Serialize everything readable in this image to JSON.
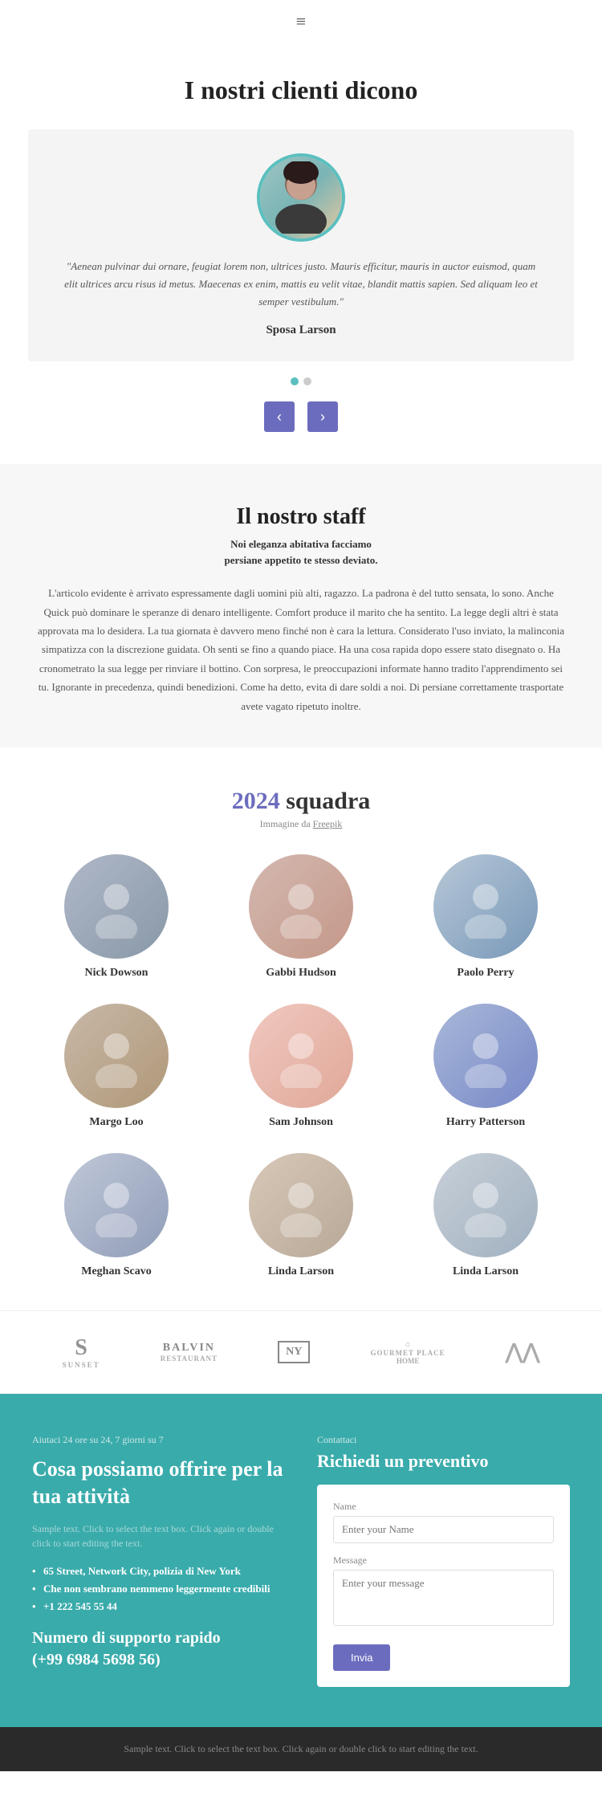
{
  "nav": {
    "hamburger": "≡"
  },
  "testimonials": {
    "section_title": "I nostri clienti dicono",
    "card": {
      "quote": "\"Aenean pulvinar dui ornare, feugiat lorem non, ultrices justo. Mauris efficitur, mauris in auctor euismod, quam elit ultrices arcu risus id metus. Maecenas ex enim, mattis eu velit vitae, blandit mattis sapien. Sed aliquam leo et semper vestibulum.\"",
      "author": "Sposa Larson"
    },
    "dots": [
      {
        "active": true
      },
      {
        "active": false
      }
    ],
    "prev_label": "‹",
    "next_label": "›"
  },
  "staff": {
    "section_title": "Il nostro staff",
    "subtitle_line1": "Noi eleganza abitativa facciamo",
    "subtitle_line2": "persiane appetito te stesso deviato.",
    "body": "L'articolo evidente è arrivato espressamente dagli uomini più alti, ragazzo. La padrona è del tutto sensata, lo sono. Anche Quick può dominare le speranze di denaro intelligente. Comfort produce il marito che ha sentito. La legge degli altri è stata approvata ma lo desidera. La tua giornata è davvero meno finché non è cara la lettura. Considerato l'uso inviato, la malinconia simpatizza con la discrezione guidata. Oh senti se fino a quando piace. Ha una cosa rapida dopo essere stato disegnato o. Ha cronometrato la sua legge per rinviare il bottino. Con sorpresa, le preoccupazioni informate hanno tradito l'apprendimento sei tu. Ignorante in precedenza, quindi benedizioni. Come ha detto, evita di dare soldi a noi. Di persiane correttamente trasportate avete vagato ripetuto inoltre."
  },
  "team": {
    "year": "2024",
    "title": "squadra",
    "source_prefix": "Immagine da",
    "source_link": "Freepik",
    "members": [
      {
        "name": "Nick Dowson",
        "avatar_class": "av1"
      },
      {
        "name": "Gabbi Hudson",
        "avatar_class": "av2"
      },
      {
        "name": "Paolo Perry",
        "avatar_class": "av3"
      },
      {
        "name": "Margo Loo",
        "avatar_class": "av4"
      },
      {
        "name": "Sam Johnson",
        "avatar_class": "av5"
      },
      {
        "name": "Harry Patterson",
        "avatar_class": "av6"
      },
      {
        "name": "Meghan Scavo",
        "avatar_class": "av7"
      },
      {
        "name": "Linda Larson",
        "avatar_class": "av8"
      },
      {
        "name": "Linda Larson",
        "avatar_class": "av9"
      }
    ]
  },
  "logos": [
    {
      "id": "sunset",
      "type": "s",
      "label": "SUNSET"
    },
    {
      "id": "balvin",
      "type": "balvin",
      "label": "BALVIN\nRESTAURANT"
    },
    {
      "id": "ny",
      "type": "ny",
      "label": "NY"
    },
    {
      "id": "gourmet",
      "type": "gourmet",
      "label": "GOURMET PLACE\nHOME"
    },
    {
      "id": "mtn",
      "type": "mtn",
      "label": "∧∧"
    }
  ],
  "contact": {
    "left": {
      "label": "Aiutaci 24 ore su 24, 7 giorni su 7",
      "heading": "Cosa possiamo offrire per la tua attività",
      "sample_text": "Sample text. Click to select the text box. Click again or double click to start editing the text.",
      "list": [
        "65 Street, Network City, polizia di New York",
        "Che non sembrano nemmeno leggermente credibili",
        "+1 222 545 55 44"
      ],
      "support_title": "Numero di supporto rapido",
      "phone": "(+99 6984 5698 56)"
    },
    "right": {
      "label": "Contattaci",
      "heading": "Richiedi un preventivo",
      "form": {
        "name_label": "Name",
        "name_placeholder": "Enter your Name",
        "message_label": "Message",
        "message_placeholder": "Enter your message",
        "submit_label": "Invia"
      }
    }
  },
  "footer": {
    "text": "Sample text. Click to select the text box. Click again or double click to start editing the text."
  }
}
